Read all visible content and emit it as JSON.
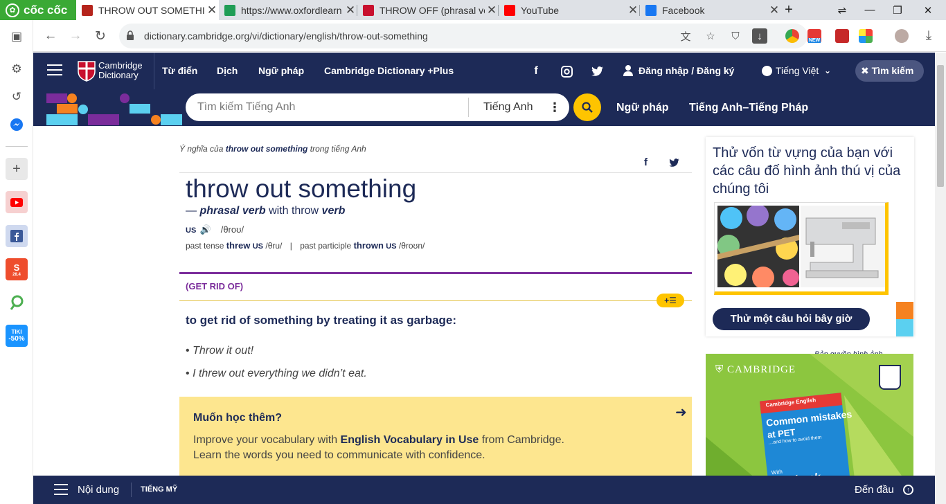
{
  "browser": {
    "brand": "cốc cốc",
    "tabs": [
      {
        "title": "THROW OUT SOMETHI",
        "favicon_color": "#b5241c",
        "active": true
      },
      {
        "title": "https://www.oxfordlearn",
        "favicon_color": "#1f9d55",
        "active": false
      },
      {
        "title": "THROW OFF (phrasal ve",
        "favicon_color": "#c8102e",
        "active": false
      },
      {
        "title": "YouTube",
        "favicon_color": "#ff0000",
        "active": false
      },
      {
        "title": "Facebook",
        "favicon_color": "#1877f2",
        "active": false
      }
    ],
    "new_tab": "+",
    "url": "dictionary.cambridge.org/vi/dictionary/english/throw-out-something",
    "ext_new_badge": "NEW"
  },
  "sidebar": {
    "shopee_badge": "28.4",
    "tiki_label": "TIKI",
    "tiki_discount": "-50%"
  },
  "nav": {
    "logo_line1": "Cambridge",
    "logo_line2": "Dictionary",
    "links": [
      "Từ điển",
      "Dịch",
      "Ngữ pháp",
      "Cambridge Dictionary +Plus"
    ],
    "login": "Đăng nhập / Đăng ký",
    "language": "Tiếng Việt",
    "search_button": "Tìm kiếm"
  },
  "search": {
    "placeholder": "Tìm kiếm Tiếng Anh",
    "dictionary": "Tiếng Anh",
    "links": [
      "Ngữ pháp",
      "Tiếng Anh–Tiếng Pháp"
    ]
  },
  "entry": {
    "meaning_prefix": "Ý nghĩa của",
    "meaning_word": "throw out something",
    "meaning_suffix": "trong tiếng Anh",
    "headword": "throw out something",
    "pos_dash": "—",
    "pos": "phrasal verb",
    "pos_with": "with throw",
    "pos_verb": "verb",
    "region": "US",
    "ipa": "/θroʊ/",
    "past_tense_label": "past tense",
    "past_tense": "threw",
    "past_tense_region": "US",
    "past_tense_ipa": "/θru/",
    "separator": "|",
    "past_participle_label": "past participle",
    "past_participle": "thrown",
    "past_participle_region": "US",
    "past_participle_ipa": "/θroʊn/",
    "guideword": "(GET RID OF)",
    "definition": "to get rid of something by treating it as garbage:",
    "examples": [
      "Throw it out!",
      "I threw out everything we didn’t eat."
    ]
  },
  "learn_more": {
    "title": "Muốn học thêm?",
    "line1_pre": "Improve your vocabulary with",
    "line1_bold": "English Vocabulary in Use",
    "line1_post": "from Cambridge.",
    "line2": "Learn the words you need to communicate with confidence."
  },
  "quiz": {
    "title": "Thử vốn từ vựng của bạn với các câu đố hình ảnh thú vị của chúng tôi",
    "copyright": "Bản quyền hình ảnh",
    "button": "Thử một câu hỏi bây giờ"
  },
  "ad": {
    "brand": "CAMBRIDGE",
    "book_series": "Cambridge English",
    "book_title_1": "Common mistakes",
    "book_title_2": "at PET",
    "book_subtitle": "…and how to avoid them",
    "book_with": "With",
    "book_testbank": "Testbank"
  },
  "bottom_bar": {
    "contents": "Nội dung",
    "dialect": "TIẾNG MỸ",
    "top": "Đến đầu"
  },
  "colors": {
    "navy": "#1d2a57",
    "yellow": "#fec400",
    "purple": "#7b2c9b",
    "learn_bg": "#fde68f"
  }
}
